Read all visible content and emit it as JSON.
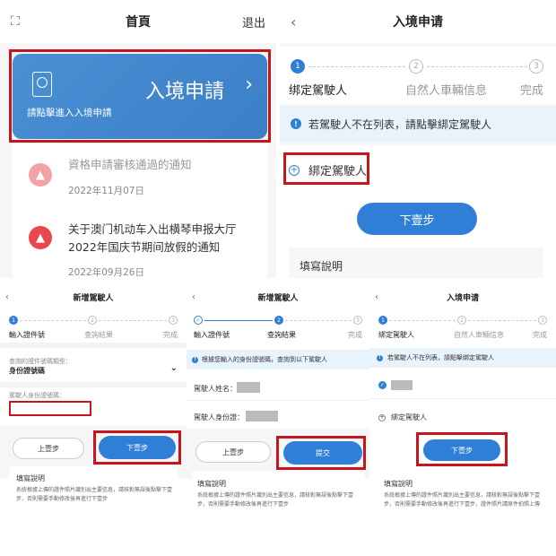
{
  "p1": {
    "title": "首頁",
    "logout": "退出",
    "card_title": "入境申請",
    "card_sub": "請點擊進入入境申請",
    "notices": [
      {
        "title": "資格申請審核通過的通知",
        "date": "2022年11月07日"
      },
      {
        "title": "关于澳门机动车入出横琴申报大厅2022年国庆节期间放假的通知",
        "date": "2022年09月26日"
      }
    ]
  },
  "p2": {
    "title": "入境申请",
    "steps": [
      "绑定駕駛人",
      "自然人車輛信息",
      "完成"
    ],
    "step_nums": [
      "1",
      "2",
      "3"
    ],
    "info": "若駕駛人不在列表，請點擊綁定駕駛人",
    "bind": "綁定駕駛人",
    "next": "下壹步",
    "help": "填寫說明"
  },
  "p3": {
    "title": "新增駕駛人",
    "steps": [
      "輸入證件號",
      "查詢結果",
      "完成"
    ],
    "step_nums": [
      "1",
      "2",
      "3"
    ],
    "type_label": "查詢的證件號碼類型：",
    "type_value": "身份證號碼",
    "id_label": "駕駛人身份證號碼：",
    "prev": "上壹步",
    "next": "下壹步",
    "help": "填寫說明",
    "help_text": "系統根據上傳的證件照片識別出主要信息，請核對無誤後點擊下壹步，否則需要手動修改後再進行下壹步"
  },
  "p4": {
    "title": "新增駕駛人",
    "steps": [
      "輸入證件號",
      "查詢結果",
      "完成"
    ],
    "step_nums": [
      "1",
      "2",
      "3"
    ],
    "info": "根據您輸入的身份證號碼，查詢到以下駕駛人",
    "name_label": "駕駛人姓名：",
    "id_label": "駕駛人身份證：",
    "prev": "上壹步",
    "submit": "提交",
    "help": "填寫說明",
    "help_text": "系統根據上傳的證件照片識別出主要信息，請核對無誤後點擊下壹步，否則需要手動修改後再進行下壹步"
  },
  "p5": {
    "title": "入境申请",
    "steps": [
      "綁定駕駛人",
      "自然人車輛信息",
      "完成"
    ],
    "step_nums": [
      "1",
      "2",
      "3"
    ],
    "info": "若駕駛人不在列表，請點擊綁定駕駛人",
    "bind": "綁定駕駛人",
    "next": "下壹步",
    "help": "填寫說明",
    "help_text": "系統根據上傳的證件照片識別出主要信息，請核對無誤後點擊下壹步，否則需要手動修改後再進行下壹步，證件照片請原件拍照上傳"
  },
  "icons": {
    "back": "‹",
    "chevron": "›",
    "check": "✓",
    "plus": "+",
    "info": "!",
    "bell": "🔔",
    "dropdown": "⌄"
  },
  "colors": {
    "primary": "#2f7fd6",
    "highlight": "#c4161c",
    "notice_bell": "#e8484c"
  }
}
